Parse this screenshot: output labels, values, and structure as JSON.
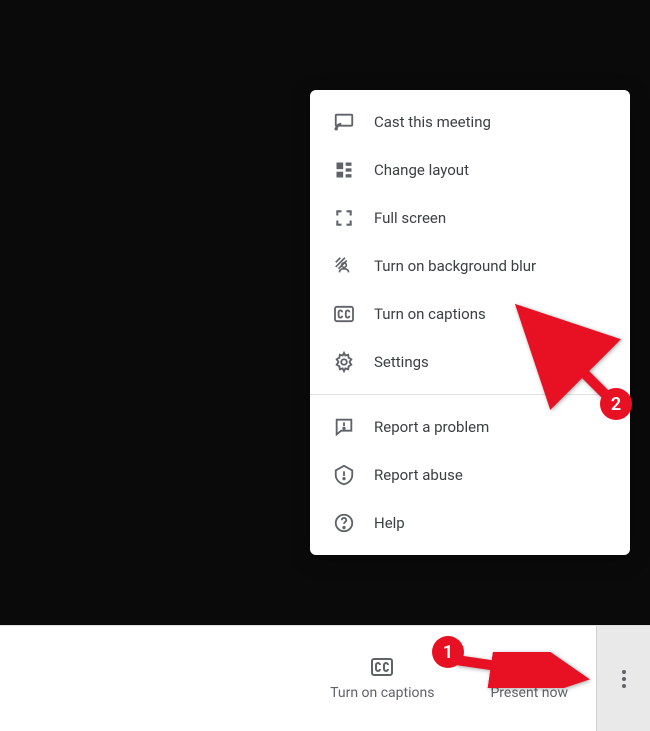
{
  "menu": {
    "items": [
      {
        "id": "cast",
        "label": "Cast this meeting"
      },
      {
        "id": "layout",
        "label": "Change layout"
      },
      {
        "id": "fullscreen",
        "label": "Full screen"
      },
      {
        "id": "blur",
        "label": "Turn on background blur"
      },
      {
        "id": "captions",
        "label": "Turn on captions"
      },
      {
        "id": "settings",
        "label": "Settings"
      },
      {
        "id": "problem",
        "label": "Report a problem"
      },
      {
        "id": "abuse",
        "label": "Report abuse"
      },
      {
        "id": "help",
        "label": "Help"
      }
    ]
  },
  "toolbar": {
    "captions": "Turn on captions",
    "present": "Present now"
  },
  "annotations": {
    "step1": "1",
    "step2": "2"
  },
  "colors": {
    "accent": "#e81123",
    "icon": "#5f6368"
  }
}
